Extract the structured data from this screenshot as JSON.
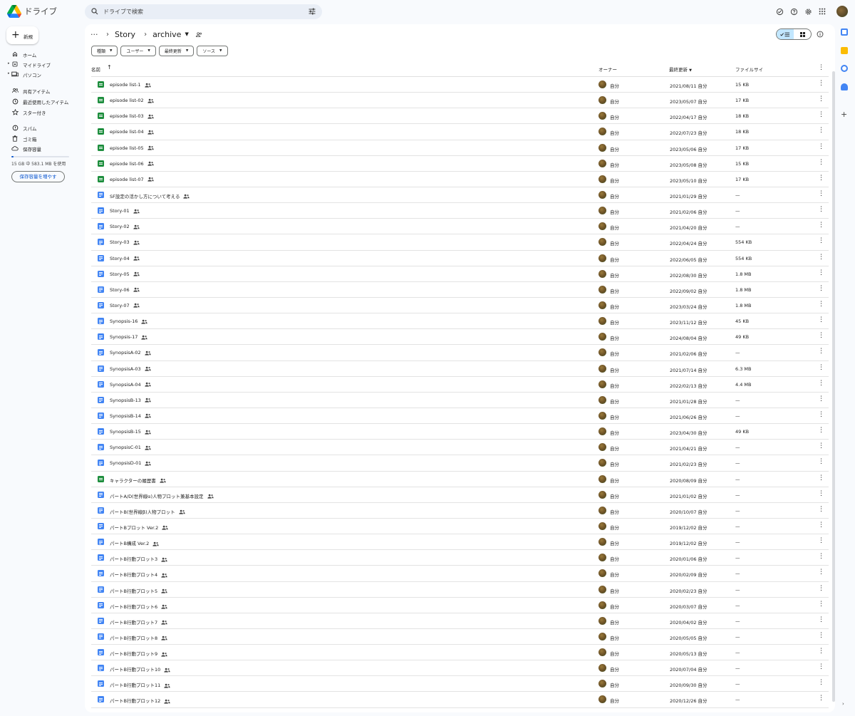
{
  "app": {
    "title": "ドライブ"
  },
  "search": {
    "placeholder": "ドライブで検索"
  },
  "sidebar": {
    "new_label": "新規",
    "items": [
      {
        "label": "ホーム",
        "icon": "home-icon"
      },
      {
        "label": "マイドライブ",
        "icon": "my-drive-icon"
      },
      {
        "label": "パソコン",
        "icon": "computers-icon"
      },
      {
        "label": "共有アイテム",
        "icon": "shared-icon"
      },
      {
        "label": "最近使用したアイテム",
        "icon": "recent-icon"
      },
      {
        "label": "スター付き",
        "icon": "star-icon"
      },
      {
        "label": "スパム",
        "icon": "spam-icon"
      },
      {
        "label": "ゴミ箱",
        "icon": "trash-icon"
      },
      {
        "label": "保存容量",
        "icon": "cloud-icon"
      }
    ],
    "storage_used_fraction": 0.04,
    "storage_text": "15 GB 中 583.1 MB を使用",
    "more_storage_label": "保存容量を増やす"
  },
  "breadcrumb": {
    "parent": "Story",
    "current": "archive"
  },
  "filters": [
    {
      "label": "種類"
    },
    {
      "label": "ユーザー"
    },
    {
      "label": "最終更新"
    },
    {
      "label": "ソース"
    }
  ],
  "table": {
    "headers": {
      "name": "名前",
      "owner": "オーナー",
      "modified": "最終更新",
      "size": "ファイルサイ"
    },
    "rows": [
      {
        "type": "sheet",
        "name": "episode list-1",
        "owner": "自分",
        "modified": "2021/08/11 自分",
        "size": "15 KB"
      },
      {
        "type": "sheet",
        "name": "episode list-02",
        "owner": "自分",
        "modified": "2023/05/07 自分",
        "size": "17 KB"
      },
      {
        "type": "sheet",
        "name": "episode list-03",
        "owner": "自分",
        "modified": "2022/04/17 自分",
        "size": "18 KB"
      },
      {
        "type": "sheet",
        "name": "episode list-04",
        "owner": "自分",
        "modified": "2022/07/23 自分",
        "size": "18 KB"
      },
      {
        "type": "sheet",
        "name": "episode list-05",
        "owner": "自分",
        "modified": "2023/05/06 自分",
        "size": "17 KB"
      },
      {
        "type": "sheet",
        "name": "episode list-06",
        "owner": "自分",
        "modified": "2023/05/08 自分",
        "size": "15 KB"
      },
      {
        "type": "sheet",
        "name": "episode list-07",
        "owner": "自分",
        "modified": "2023/05/10 自分",
        "size": "17 KB"
      },
      {
        "type": "doc",
        "name": "SF設定の活かし方について考える",
        "owner": "自分",
        "modified": "2021/01/29 自分",
        "size": "—"
      },
      {
        "type": "doc",
        "name": "Story-01",
        "owner": "自分",
        "modified": "2021/02/06 自分",
        "size": "—"
      },
      {
        "type": "doc",
        "name": "Story-02",
        "owner": "自分",
        "modified": "2021/04/20 自分",
        "size": "—"
      },
      {
        "type": "doc",
        "name": "Story-03",
        "owner": "自分",
        "modified": "2022/04/24 自分",
        "size": "554 KB"
      },
      {
        "type": "doc",
        "name": "Story-04",
        "owner": "自分",
        "modified": "2022/06/05 自分",
        "size": "554 KB"
      },
      {
        "type": "doc",
        "name": "Story-05",
        "owner": "自分",
        "modified": "2022/08/30 自分",
        "size": "1.8 MB"
      },
      {
        "type": "doc",
        "name": "Story-06",
        "owner": "自分",
        "modified": "2022/09/02 自分",
        "size": "1.8 MB"
      },
      {
        "type": "doc",
        "name": "Story-07",
        "owner": "自分",
        "modified": "2023/03/24 自分",
        "size": "1.8 MB"
      },
      {
        "type": "doc",
        "name": "Synopsis-16",
        "owner": "自分",
        "modified": "2023/11/12 自分",
        "size": "45 KB"
      },
      {
        "type": "doc",
        "name": "Synopsis-17",
        "owner": "自分",
        "modified": "2024/08/04 自分",
        "size": "49 KB"
      },
      {
        "type": "doc",
        "name": "SynopsisA-02",
        "owner": "自分",
        "modified": "2021/02/06 自分",
        "size": "—"
      },
      {
        "type": "doc",
        "name": "SynopsisA-03",
        "owner": "自分",
        "modified": "2021/07/14 自分",
        "size": "6.3 MB"
      },
      {
        "type": "doc",
        "name": "SynopsisA-04",
        "owner": "自分",
        "modified": "2022/02/13 自分",
        "size": "4.4 MB"
      },
      {
        "type": "doc",
        "name": "SynopsisB-13",
        "owner": "自分",
        "modified": "2021/01/28 自分",
        "size": "—"
      },
      {
        "type": "doc",
        "name": "SynopsisB-14",
        "owner": "自分",
        "modified": "2021/06/26 自分",
        "size": "—"
      },
      {
        "type": "doc",
        "name": "SynopsisB-15",
        "owner": "自分",
        "modified": "2023/04/30 自分",
        "size": "49 KB"
      },
      {
        "type": "doc",
        "name": "SynopsisC-01",
        "owner": "自分",
        "modified": "2021/04/21 自分",
        "size": "—"
      },
      {
        "type": "doc",
        "name": "SynopsisD-01",
        "owner": "自分",
        "modified": "2021/02/23 自分",
        "size": "—"
      },
      {
        "type": "sheet",
        "name": "キャラクターの履歴書",
        "owner": "自分",
        "modified": "2020/08/09 自分",
        "size": "—"
      },
      {
        "type": "doc",
        "name": "パートA/D(世界線α)人物プロット兼基本設定",
        "owner": "自分",
        "modified": "2021/01/02 自分",
        "size": "—"
      },
      {
        "type": "doc",
        "name": "パートB(世界線β)人物プロット",
        "owner": "自分",
        "modified": "2020/10/07 自分",
        "size": "—"
      },
      {
        "type": "doc",
        "name": "パートBプロット Ver.2",
        "owner": "自分",
        "modified": "2019/12/02 自分",
        "size": "—"
      },
      {
        "type": "doc",
        "name": "パートB構成 Ver.2",
        "owner": "自分",
        "modified": "2019/12/02 自分",
        "size": "—"
      },
      {
        "type": "doc",
        "name": "パートB行動プロット3",
        "owner": "自分",
        "modified": "2020/01/06 自分",
        "size": "—"
      },
      {
        "type": "doc",
        "name": "パートB行動プロット4",
        "owner": "自分",
        "modified": "2020/02/09 自分",
        "size": "—"
      },
      {
        "type": "doc",
        "name": "パートB行動プロット5",
        "owner": "自分",
        "modified": "2020/02/23 自分",
        "size": "—"
      },
      {
        "type": "doc",
        "name": "パートB行動プロット6",
        "owner": "自分",
        "modified": "2020/03/07 自分",
        "size": "—"
      },
      {
        "type": "doc",
        "name": "パートB行動プロット7",
        "owner": "自分",
        "modified": "2020/04/02 自分",
        "size": "—"
      },
      {
        "type": "doc",
        "name": "パートB行動プロット8",
        "owner": "自分",
        "modified": "2020/05/05 自分",
        "size": "—"
      },
      {
        "type": "doc",
        "name": "パートB行動プロット9",
        "owner": "自分",
        "modified": "2020/05/13 自分",
        "size": "—"
      },
      {
        "type": "doc",
        "name": "パートB行動プロット10",
        "owner": "自分",
        "modified": "2020/07/04 自分",
        "size": "—"
      },
      {
        "type": "doc",
        "name": "パートB行動プロット11",
        "owner": "自分",
        "modified": "2020/09/30 自分",
        "size": "—"
      },
      {
        "type": "doc",
        "name": "パートB行動プロット12",
        "owner": "自分",
        "modified": "2020/12/26 自分",
        "size": "—"
      }
    ]
  },
  "colors": {
    "accent": "#0b57d0",
    "sheet": "#1e8e3e",
    "doc": "#4285f4",
    "selected_view": "#c2e7ff"
  }
}
